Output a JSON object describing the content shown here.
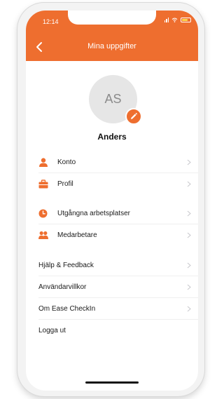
{
  "status": {
    "time": "12:14"
  },
  "nav": {
    "title": "Mina uppgifter"
  },
  "profile": {
    "initials": "AS",
    "name": "Anders"
  },
  "menu": {
    "group1": [
      {
        "label": "Konto",
        "icon": "person-icon"
      },
      {
        "label": "Profil",
        "icon": "briefcase-icon"
      }
    ],
    "group2": [
      {
        "label": "Utgångna arbetsplatser",
        "icon": "clock-icon"
      },
      {
        "label": "Medarbetare",
        "icon": "people-icon"
      }
    ],
    "group3": [
      {
        "label": "Hjälp & Feedback"
      },
      {
        "label": "Användarvillkor"
      },
      {
        "label": "Om Ease CheckIn"
      },
      {
        "label": "Logga ut"
      }
    ]
  },
  "colors": {
    "accent": "#ee6e2f",
    "text": "#1a1a1a",
    "chevron": "#c7c7cc"
  }
}
